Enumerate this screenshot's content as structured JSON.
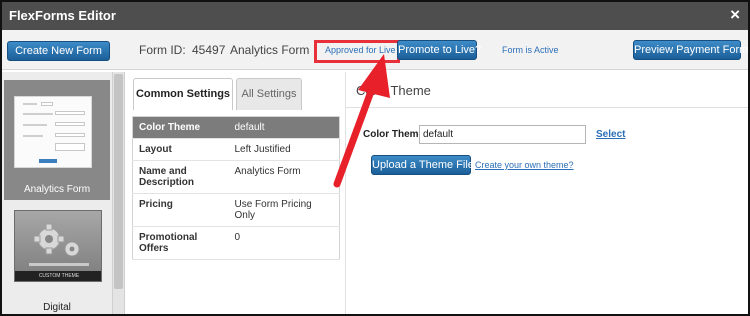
{
  "window": {
    "title": "FlexForms Editor",
    "close_glyph": "×"
  },
  "toolbar": {
    "create_new_form": "Create New Form",
    "form_id_label": "Form ID:",
    "form_id_value": "45497",
    "form_name": "Analytics Form",
    "approved_link": "Approved for Live",
    "promote_button": "Promote to Live?",
    "form_status": "Form is Active",
    "preview_payment_form": "Preview Payment Form"
  },
  "thumbnails": [
    {
      "caption": "Analytics Form",
      "icon": "form-preview-thumbnail"
    },
    {
      "caption": "Digital",
      "ribbon": "CUSTOM THEME",
      "icon": "gear-icon"
    }
  ],
  "settings": {
    "tabs": [
      "Common Settings",
      "All Settings"
    ],
    "rows": [
      {
        "key": "Color Theme",
        "value": "default"
      },
      {
        "key": "Layout",
        "value": "Left Justified"
      },
      {
        "key": "Name and Description",
        "value": "Analytics Form"
      },
      {
        "key": "Pricing",
        "value": "Use Form Pricing Only"
      },
      {
        "key": "Promotional Offers",
        "value": "0"
      }
    ]
  },
  "main": {
    "heading": "Color Theme",
    "theme_label": "Color Theme",
    "theme_value": "default",
    "select_link": "Select",
    "upload_button": "Upload a Theme File",
    "create_theme_link": "Create your own theme?"
  },
  "colors": {
    "titlebar": "#4e4e4e",
    "button_blue": "#1b5f99",
    "link_blue": "#2b6fb6",
    "highlight_red": "#e8303a",
    "selected_row": "#7c7c7c"
  }
}
